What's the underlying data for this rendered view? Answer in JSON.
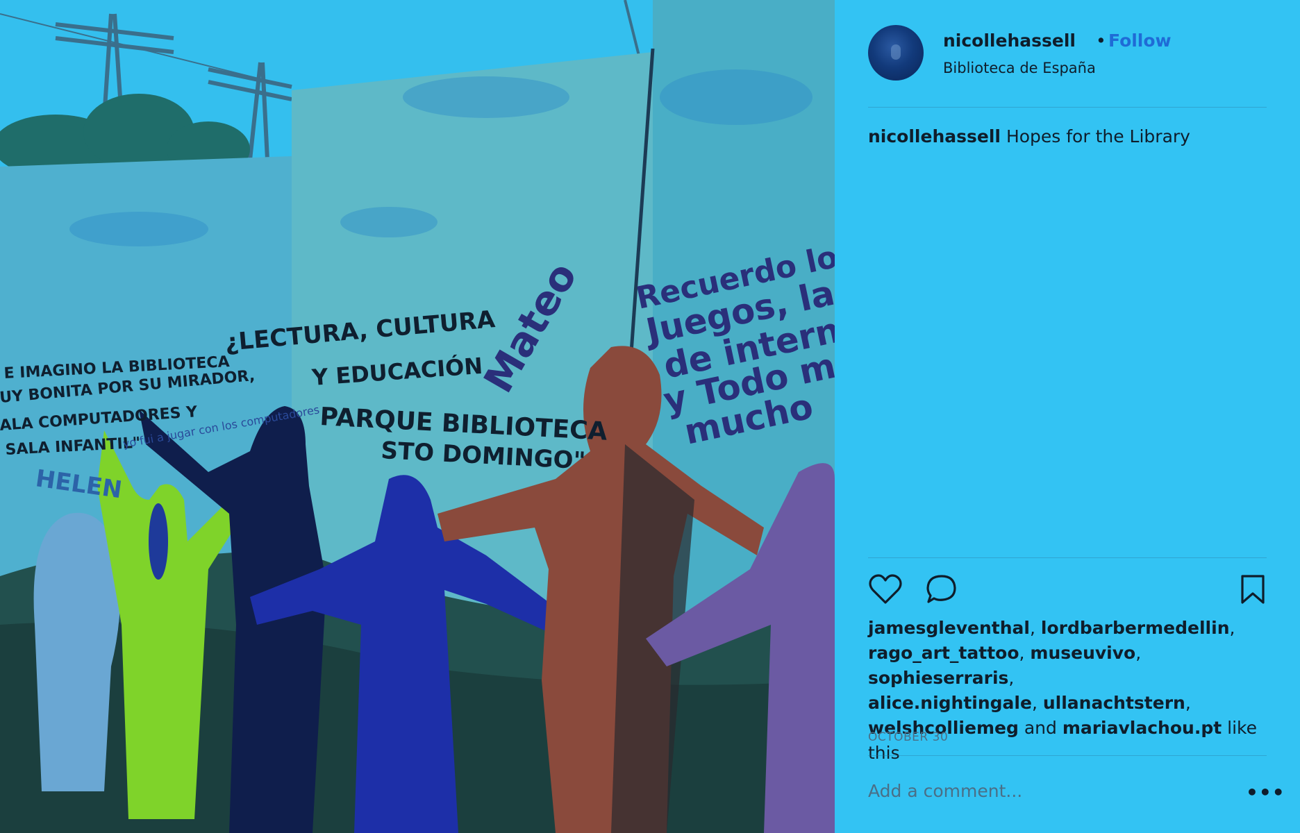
{
  "photo": {
    "mural_texts": [
      "¿LECTURA, CULTURA",
      "Y EDUCACIÓN",
      "PARQUE BIBLIOTECA",
      "STO DOMINGO\"",
      "E IMAGINO LA BIBLIOTECA",
      "UY BONITA POR SU MIRADOR,",
      "ALA COMPUTADORES Y",
      "SALA INFANTIL\"",
      "HELEN",
      "Mateo",
      "Recuerdo los",
      "Juegos, la s",
      "de intern",
      "y Todo me",
      "mucho",
      "yo fui a jugar con los computadores"
    ]
  },
  "post": {
    "username": "nicollehassell",
    "separator": "•",
    "follow_label": "Follow",
    "location": "Biblioteca de España",
    "caption_user": "nicollehassell",
    "caption_text": "Hopes for the Library",
    "likers": [
      "jamesgleventhal",
      "lordbarbermedellin",
      "rago_art_tattoo",
      "museuvivo",
      "sophieserraris",
      "alice.nightingale",
      "ullanachtstern",
      "welshcolliemeg",
      "mariavlachou.pt"
    ],
    "likes_and": "and",
    "likes_suffix": "like this",
    "date": "OCTOBER 30",
    "comment_placeholder": "Add a comment...",
    "more_label": "•••"
  },
  "icons": {
    "like": "heart-icon",
    "comment": "speech-bubble-icon",
    "save": "bookmark-icon",
    "more": "ellipsis-icon"
  },
  "colors": {
    "background": "#33c3f3",
    "follow": "#1f6bd6",
    "text": "#0f1d2b"
  }
}
